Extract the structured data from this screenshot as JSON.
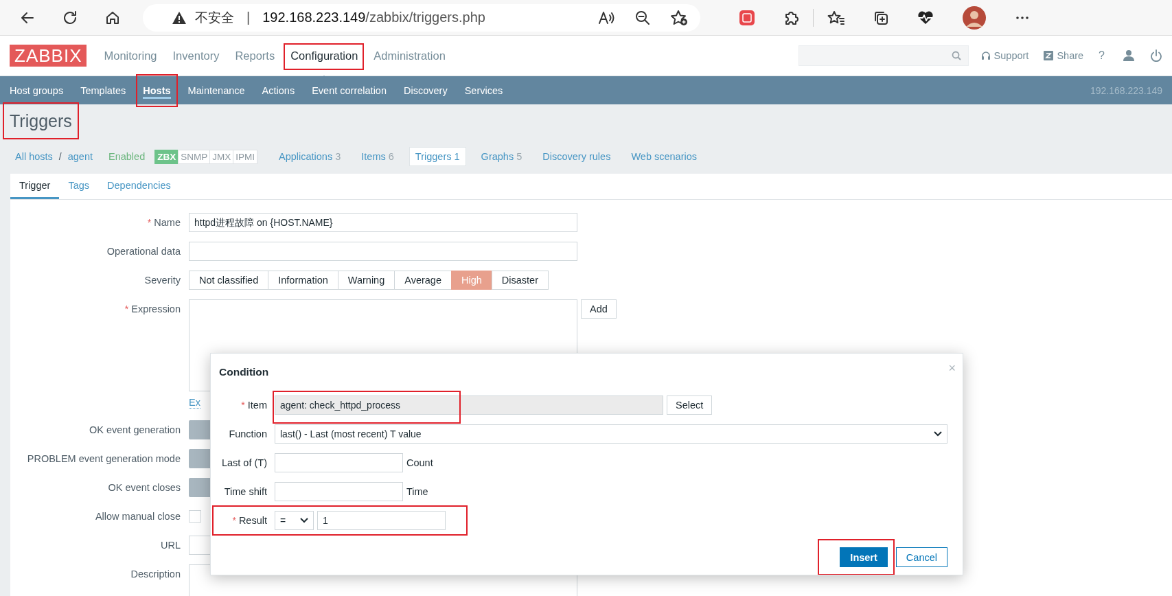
{
  "browser": {
    "security_label": "不安全",
    "separator": "|",
    "url_host": "192.168.223.149",
    "url_path": "/zabbix/triggers.php"
  },
  "header": {
    "logo": "ZABBIX",
    "menu": [
      {
        "label": "Monitoring",
        "selected": false,
        "highlighted": false
      },
      {
        "label": "Inventory",
        "selected": false,
        "highlighted": false
      },
      {
        "label": "Reports",
        "selected": false,
        "highlighted": false
      },
      {
        "label": "Configuration",
        "selected": true,
        "highlighted": true
      },
      {
        "label": "Administration",
        "selected": false,
        "highlighted": false
      }
    ],
    "support": "Support",
    "share": "Share",
    "help": "?"
  },
  "subnav": {
    "items": [
      {
        "label": "Host groups",
        "selected": false,
        "highlighted": false
      },
      {
        "label": "Templates",
        "selected": false,
        "highlighted": false
      },
      {
        "label": "Hosts",
        "selected": true,
        "highlighted": true
      },
      {
        "label": "Maintenance",
        "selected": false,
        "highlighted": false
      },
      {
        "label": "Actions",
        "selected": false,
        "highlighted": false
      },
      {
        "label": "Event correlation",
        "selected": false,
        "highlighted": false
      },
      {
        "label": "Discovery",
        "selected": false,
        "highlighted": false
      },
      {
        "label": "Services",
        "selected": false,
        "highlighted": false
      }
    ],
    "server": "192.168.223.149"
  },
  "page_title": {
    "text": "Triggers",
    "highlighted": true
  },
  "breadcrumbs": {
    "all_hosts": "All hosts",
    "separator": "/",
    "host": "agent",
    "status": "Enabled",
    "interfaces": [
      {
        "label": "ZBX",
        "available": true
      },
      {
        "label": "SNMP",
        "available": false
      },
      {
        "label": "JMX",
        "available": false
      },
      {
        "label": "IPMI",
        "available": false
      }
    ],
    "links": [
      {
        "label": "Applications",
        "count": "3",
        "selected": false
      },
      {
        "label": "Items",
        "count": "6",
        "selected": false
      },
      {
        "label": "Triggers",
        "count": "1",
        "selected": true
      },
      {
        "label": "Graphs",
        "count": "5",
        "selected": false
      },
      {
        "label": "Discovery rules",
        "selected": false
      },
      {
        "label": "Web scenarios",
        "selected": false
      }
    ]
  },
  "tabs": [
    {
      "label": "Trigger",
      "selected": true
    },
    {
      "label": "Tags",
      "selected": false
    },
    {
      "label": "Dependencies",
      "selected": false
    }
  ],
  "form": {
    "rows": [
      {
        "kind": "text",
        "label": "Name",
        "marker": "*",
        "value": "httpd进程故障 on {HOST.NAME}"
      },
      {
        "kind": "text",
        "label": "Operational data"
      },
      {
        "kind": "severity",
        "label": "Severity",
        "options": [
          {
            "label": "Not classified",
            "selected": false
          },
          {
            "label": "Information",
            "selected": false
          },
          {
            "label": "Warning",
            "selected": false
          },
          {
            "label": "Average",
            "selected": false
          },
          {
            "label": "High",
            "selected": true
          },
          {
            "label": "Disaster",
            "selected": false
          }
        ]
      },
      {
        "kind": "expression",
        "label": "Expression",
        "marker": "*",
        "button": "Add",
        "link": "Ex"
      },
      {
        "kind": "segmented",
        "label": "OK event generation"
      },
      {
        "kind": "segmented",
        "label": "PROBLEM event generation mode"
      },
      {
        "kind": "segmented",
        "label": "OK event closes"
      },
      {
        "kind": "checkbox",
        "label": "Allow manual close",
        "checked": false
      },
      {
        "kind": "text",
        "label": "URL"
      },
      {
        "kind": "textarea",
        "label": "Description"
      }
    ]
  },
  "dialog": {
    "title": "Condition",
    "close": "×",
    "rows": [
      {
        "kind": "item",
        "label": "Item",
        "marker": "*",
        "value": "agent: check_httpd_process",
        "button": "Select",
        "highlighted": true
      },
      {
        "kind": "select",
        "label": "Function",
        "value": "last() - Last (most recent) T value",
        "highlighted": false
      },
      {
        "kind": "input",
        "label": "Last of (T)",
        "suffix": "Count",
        "highlighted": false
      },
      {
        "kind": "input",
        "label": "Time shift",
        "suffix": "Time",
        "highlighted": false
      },
      {
        "kind": "result",
        "label": "Result",
        "marker": "*",
        "operator": "=",
        "value": "1",
        "highlighted": true
      }
    ],
    "buttons": [
      {
        "label": "Insert",
        "kind": "primary",
        "highlighted": true
      },
      {
        "label": "Cancel",
        "kind": "secondary",
        "highlighted": false
      }
    ]
  }
}
